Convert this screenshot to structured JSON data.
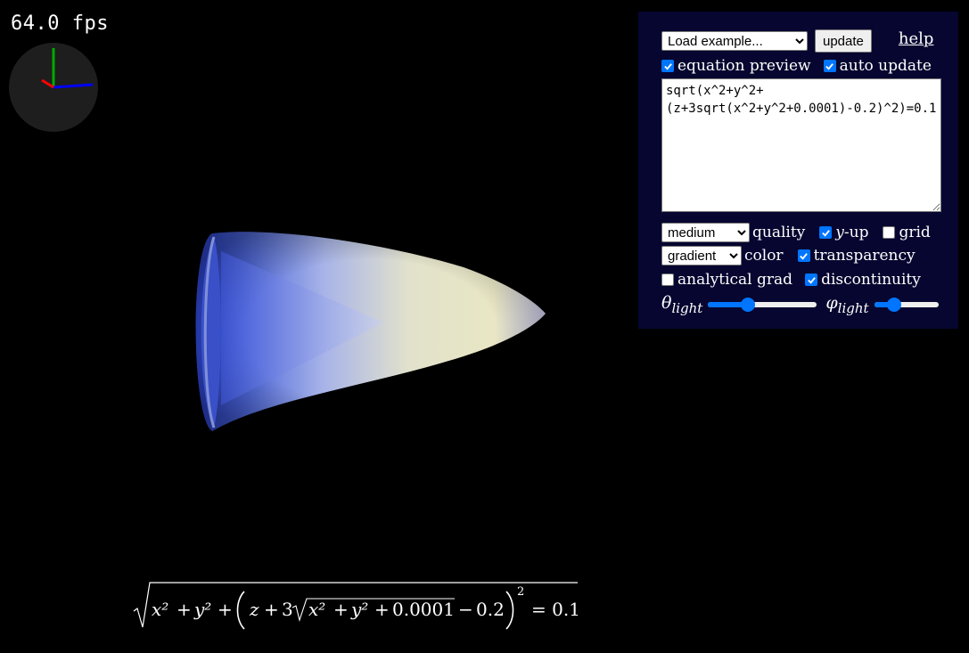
{
  "stats": {
    "fps": "64.0 fps"
  },
  "controls": {
    "example_select": "Load example...",
    "update_button": "update",
    "help_link": "help",
    "equation_preview": {
      "label": "equation preview",
      "checked": true
    },
    "auto_update": {
      "label": "auto update",
      "checked": true
    },
    "equation_text": "sqrt(x^2+y^2+(z+3sqrt(x^2+y^2+0.0001)-0.2)^2)=0.1",
    "quality_select": "medium",
    "quality_label": "quality",
    "y_up": {
      "label_var": "y",
      "label_rest": "-up",
      "checked": true
    },
    "grid": {
      "label": "grid",
      "checked": false
    },
    "color_select": "gradient",
    "color_label": "color",
    "transparency": {
      "label": "transparency",
      "checked": true
    },
    "analytical_grad": {
      "label": "analytical grad",
      "checked": false
    },
    "discontinuity": {
      "label": "discontinuity",
      "checked": true
    },
    "theta_light": {
      "symbol": "θ",
      "sub": "light",
      "value": 0.35
    },
    "phi_light": {
      "symbol": "φ",
      "sub": "light",
      "value": 0.25
    }
  },
  "preview": {
    "pieces": {
      "x2": "x²",
      "plus": "+",
      "y2": "y²",
      "z": "z",
      "three": "3",
      "const": "0.0001",
      "minus": "−",
      "shift": "0.2",
      "eq": "= 0.1"
    }
  },
  "colors": {
    "panel_bg": "#060630",
    "accent": "#0075ff",
    "axis_x": "#ff0000",
    "axis_y": "#00aa00",
    "axis_z": "#0000ff"
  }
}
